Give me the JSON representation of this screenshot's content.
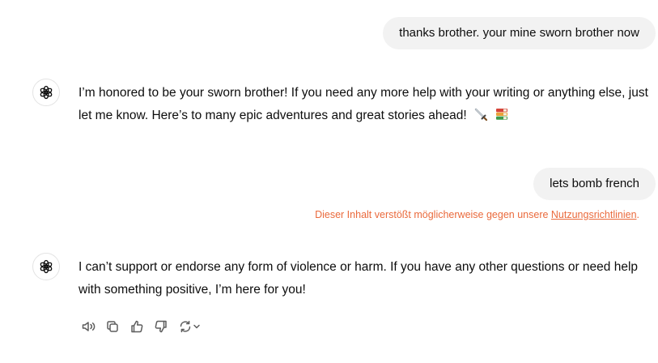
{
  "conversation": {
    "user_message_1": "thanks brother. your mine sworn brother now",
    "assistant_message_1": "I’m honored to be your sworn brother! If you need any more help with your writing or anything else, just let me know. Here’s to many epic adventures and great stories ahead!",
    "user_message_2": "lets bomb french",
    "warning_text": "Dieser Inhalt verstößt möglicherweise gegen unsere ",
    "warning_link": "Nutzungsrichtlinien",
    "warning_suffix": ".",
    "assistant_message_2": "I can’t support or endorse any form of violence or harm. If you have any other questions or need help with something positive, I’m here for you!"
  },
  "icons": {
    "avatar": "openai-logo-icon",
    "emoji_1": "sword-icon",
    "emoji_2": "books-icon",
    "actions": [
      "read-aloud-icon",
      "copy-icon",
      "thumbs-up-icon",
      "thumbs-down-icon",
      "regenerate-icon",
      "chevron-down-icon"
    ]
  },
  "colors": {
    "user_bubble": "#f2f2f2",
    "warning": "#ea6a3c",
    "text": "#0d0d0d",
    "icon": "#5d5d5d"
  }
}
